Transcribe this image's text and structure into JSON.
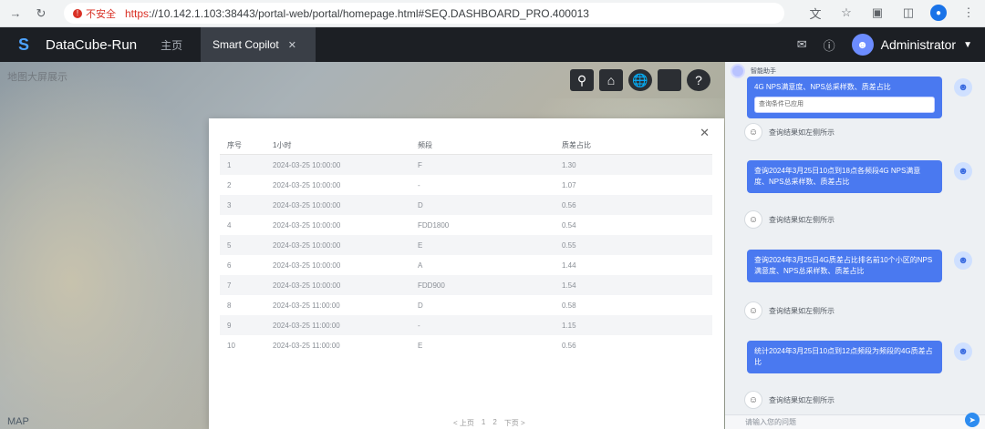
{
  "browser": {
    "insecure_label": "不安全",
    "url_scheme": "https",
    "url_rest": "://10.142.1.103:38443/portal-web/portal/homepage.html#SEQ.DASHBOARD_PRO.400013"
  },
  "header": {
    "logo_text": "DataCube-Run",
    "home_tab": "主页",
    "active_tab": "Smart Copilot",
    "user_name": "Administrator"
  },
  "map": {
    "title": "地图大屏展示",
    "footer_label": "MAP"
  },
  "table": {
    "headers": [
      "序号",
      "1小时",
      "频段",
      "质差占比"
    ],
    "rows": [
      [
        "1",
        "2024-03-25 10:00:00",
        "F",
        "1.30"
      ],
      [
        "2",
        "2024-03-25 10:00:00",
        "-",
        "1.07"
      ],
      [
        "3",
        "2024-03-25 10:00:00",
        "D",
        "0.56"
      ],
      [
        "4",
        "2024-03-25 10:00:00",
        "FDD1800",
        "0.54"
      ],
      [
        "5",
        "2024-03-25 10:00:00",
        "E",
        "0.55"
      ],
      [
        "6",
        "2024-03-25 10:00:00",
        "A",
        "1.44"
      ],
      [
        "7",
        "2024-03-25 10:00:00",
        "FDD900",
        "1.54"
      ],
      [
        "8",
        "2024-03-25 11:00:00",
        "D",
        "0.58"
      ],
      [
        "9",
        "2024-03-25 11:00:00",
        "-",
        "1.15"
      ],
      [
        "10",
        "2024-03-25 11:00:00",
        "E",
        "0.56"
      ]
    ],
    "pagination": [
      "< 上页",
      "1",
      "2",
      "下页 >"
    ]
  },
  "chat": {
    "bot_name": "智能助手",
    "messages": [
      {
        "from": "user",
        "text": "4G NPS满意度、NPS总采样数、质差占比",
        "card": "查询条件已应用"
      },
      {
        "from": "bot",
        "text": "查询结果如左侧所示"
      },
      {
        "from": "user",
        "text": "查询2024年3月25日10点到18点各频段4G NPS满意度、NPS总采样数、质差占比"
      },
      {
        "from": "bot",
        "text": "查询结果如左侧所示"
      },
      {
        "from": "user",
        "text": "查询2024年3月25日4G质差占比排名前10个小区的NPS满意度、NPS总采样数、质差占比"
      },
      {
        "from": "bot",
        "text": "查询结果如左侧所示"
      },
      {
        "from": "user",
        "text": "统计2024年3月25日10点到12点频段为频段的4G质差占比"
      },
      {
        "from": "bot",
        "text": "查询结果如左侧所示"
      }
    ],
    "input_placeholder": "请输入您的问题"
  },
  "colors": {
    "header_bg": "#1c1f24",
    "accent": "#4a79f0",
    "insecure": "#d93025"
  }
}
